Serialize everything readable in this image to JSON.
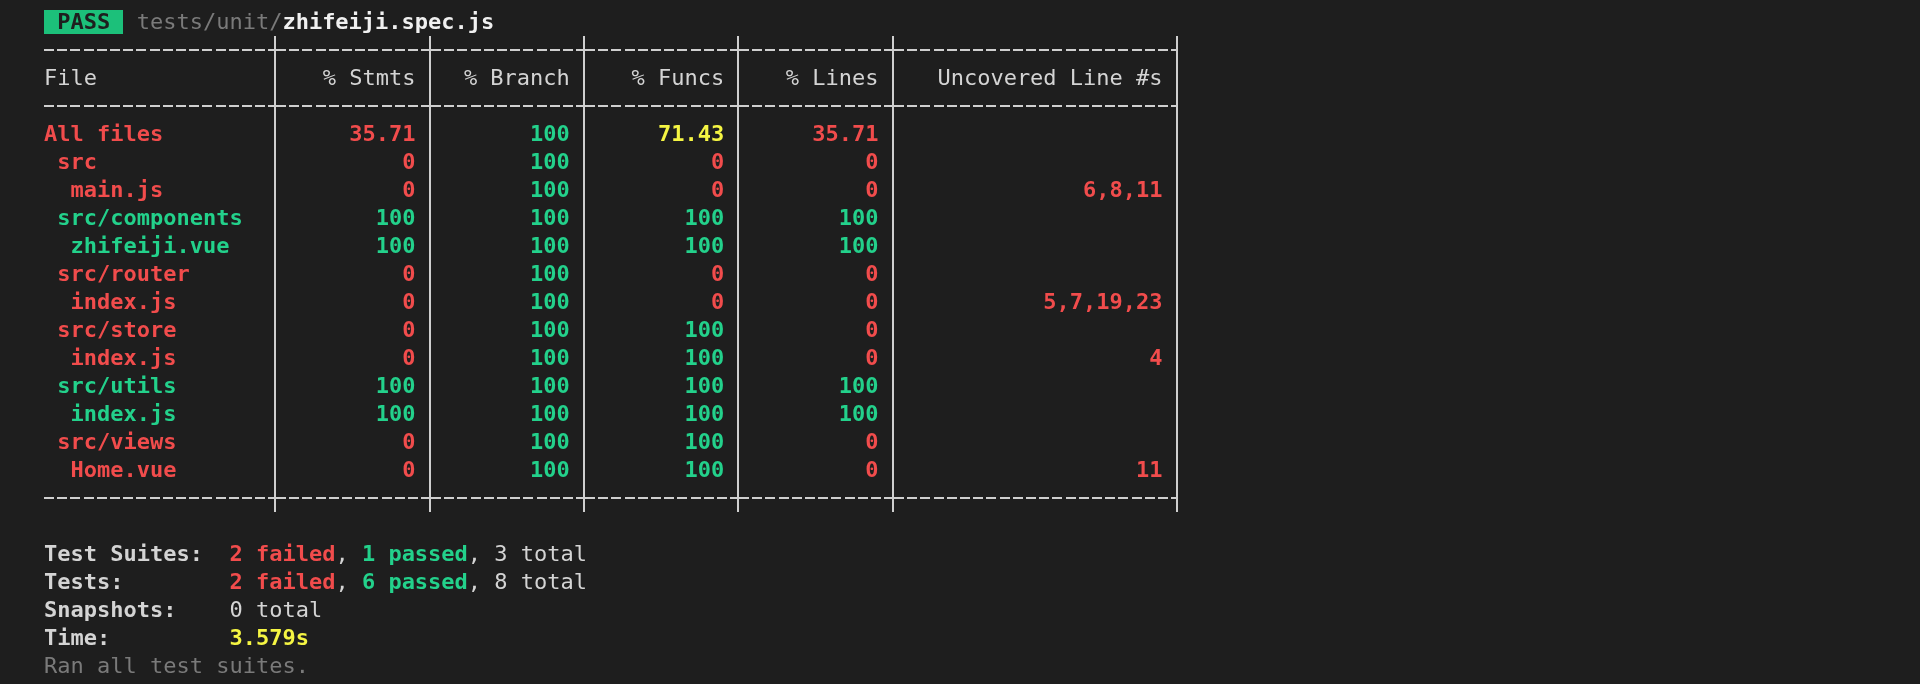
{
  "header": {
    "badge": "PASS",
    "path_dir": "tests/unit/",
    "path_file": "zhifeiji.spec.js"
  },
  "coverage_table": {
    "columns": [
      "File",
      "% Stmts",
      "% Branch",
      "% Funcs",
      "% Lines",
      "Uncovered Line #s"
    ],
    "rows": [
      {
        "cells": [
          {
            "text": "All files",
            "color": "#f14c4c"
          },
          {
            "text": "35.71",
            "color": "#f14c4c"
          },
          {
            "text": "100",
            "color": "#23d18b"
          },
          {
            "text": "71.43",
            "color": "#f5f543"
          },
          {
            "text": "35.71",
            "color": "#f14c4c"
          },
          {
            "text": ""
          }
        ],
        "children": [
          {
            "cells": [
              {
                "text": "src",
                "color": "#f14c4c"
              },
              {
                "text": "0",
                "color": "#f14c4c"
              },
              {
                "text": "100",
                "color": "#23d18b"
              },
              {
                "text": "0",
                "color": "#f14c4c"
              },
              {
                "text": "0",
                "color": "#f14c4c"
              },
              {
                "text": ""
              }
            ],
            "children": [
              {
                "cells": [
                  {
                    "text": "main.js",
                    "color": "#f14c4c"
                  },
                  {
                    "text": "0",
                    "color": "#f14c4c"
                  },
                  {
                    "text": "100",
                    "color": "#23d18b"
                  },
                  {
                    "text": "0",
                    "color": "#f14c4c"
                  },
                  {
                    "text": "0",
                    "color": "#f14c4c"
                  },
                  {
                    "text": "6,8,11",
                    "color": "#f14c4c"
                  }
                ]
              }
            ]
          },
          {
            "cells": [
              {
                "text": "src/components",
                "color": "#23d18b"
              },
              {
                "text": "100",
                "color": "#23d18b"
              },
              {
                "text": "100",
                "color": "#23d18b"
              },
              {
                "text": "100",
                "color": "#23d18b"
              },
              {
                "text": "100",
                "color": "#23d18b"
              },
              {
                "text": ""
              }
            ],
            "children": [
              {
                "cells": [
                  {
                    "text": "zhifeiji.vue",
                    "color": "#23d18b"
                  },
                  {
                    "text": "100",
                    "color": "#23d18b"
                  },
                  {
                    "text": "100",
                    "color": "#23d18b"
                  },
                  {
                    "text": "100",
                    "color": "#23d18b"
                  },
                  {
                    "text": "100",
                    "color": "#23d18b"
                  },
                  {
                    "text": ""
                  }
                ]
              }
            ]
          },
          {
            "cells": [
              {
                "text": "src/router",
                "color": "#f14c4c"
              },
              {
                "text": "0",
                "color": "#f14c4c"
              },
              {
                "text": "100",
                "color": "#23d18b"
              },
              {
                "text": "0",
                "color": "#f14c4c"
              },
              {
                "text": "0",
                "color": "#f14c4c"
              },
              {
                "text": ""
              }
            ],
            "children": [
              {
                "cells": [
                  {
                    "text": "index.js",
                    "color": "#f14c4c"
                  },
                  {
                    "text": "0",
                    "color": "#f14c4c"
                  },
                  {
                    "text": "100",
                    "color": "#23d18b"
                  },
                  {
                    "text": "0",
                    "color": "#f14c4c"
                  },
                  {
                    "text": "0",
                    "color": "#f14c4c"
                  },
                  {
                    "text": "5,7,19,23",
                    "color": "#f14c4c"
                  }
                ]
              }
            ]
          },
          {
            "cells": [
              {
                "text": "src/store",
                "color": "#f14c4c"
              },
              {
                "text": "0",
                "color": "#f14c4c"
              },
              {
                "text": "100",
                "color": "#23d18b"
              },
              {
                "text": "100",
                "color": "#23d18b"
              },
              {
                "text": "0",
                "color": "#f14c4c"
              },
              {
                "text": ""
              }
            ],
            "children": [
              {
                "cells": [
                  {
                    "text": "index.js",
                    "color": "#f14c4c"
                  },
                  {
                    "text": "0",
                    "color": "#f14c4c"
                  },
                  {
                    "text": "100",
                    "color": "#23d18b"
                  },
                  {
                    "text": "100",
                    "color": "#23d18b"
                  },
                  {
                    "text": "0",
                    "color": "#f14c4c"
                  },
                  {
                    "text": "4",
                    "color": "#f14c4c"
                  }
                ]
              }
            ]
          },
          {
            "cells": [
              {
                "text": "src/utils",
                "color": "#23d18b"
              },
              {
                "text": "100",
                "color": "#23d18b"
              },
              {
                "text": "100",
                "color": "#23d18b"
              },
              {
                "text": "100",
                "color": "#23d18b"
              },
              {
                "text": "100",
                "color": "#23d18b"
              },
              {
                "text": ""
              }
            ],
            "children": [
              {
                "cells": [
                  {
                    "text": "index.js",
                    "color": "#23d18b"
                  },
                  {
                    "text": "100",
                    "color": "#23d18b"
                  },
                  {
                    "text": "100",
                    "color": "#23d18b"
                  },
                  {
                    "text": "100",
                    "color": "#23d18b"
                  },
                  {
                    "text": "100",
                    "color": "#23d18b"
                  },
                  {
                    "text": ""
                  }
                ]
              }
            ]
          },
          {
            "cells": [
              {
                "text": "src/views",
                "color": "#f14c4c"
              },
              {
                "text": "0",
                "color": "#f14c4c"
              },
              {
                "text": "100",
                "color": "#23d18b"
              },
              {
                "text": "100",
                "color": "#23d18b"
              },
              {
                "text": "0",
                "color": "#f14c4c"
              },
              {
                "text": ""
              }
            ],
            "children": [
              {
                "cells": [
                  {
                    "text": "Home.vue",
                    "color": "#f14c4c"
                  },
                  {
                    "text": "0",
                    "color": "#f14c4c"
                  },
                  {
                    "text": "100",
                    "color": "#23d18b"
                  },
                  {
                    "text": "100",
                    "color": "#23d18b"
                  },
                  {
                    "text": "0",
                    "color": "#f14c4c"
                  },
                  {
                    "text": "11",
                    "color": "#f14c4c"
                  }
                ]
              }
            ]
          }
        ]
      }
    ]
  },
  "summary": [
    {
      "label": "Test Suites:",
      "parts": [
        {
          "text": "2 failed",
          "kind": "failed"
        },
        {
          "text": ", ",
          "kind": "plain"
        },
        {
          "text": "1 passed",
          "kind": "passed"
        },
        {
          "text": ", 3 total",
          "kind": "plain"
        }
      ]
    },
    {
      "label": "Tests:",
      "parts": [
        {
          "text": "2 failed",
          "kind": "failed"
        },
        {
          "text": ", ",
          "kind": "plain"
        },
        {
          "text": "6 passed",
          "kind": "passed"
        },
        {
          "text": ", 8 total",
          "kind": "plain"
        }
      ]
    },
    {
      "label": "Snapshots:",
      "parts": [
        {
          "text": "0 total",
          "kind": "plain"
        }
      ]
    },
    {
      "label": "Time:",
      "parts": [
        {
          "text": "3.579s",
          "kind": "time"
        }
      ]
    }
  ],
  "footer": "Ran all test suites."
}
